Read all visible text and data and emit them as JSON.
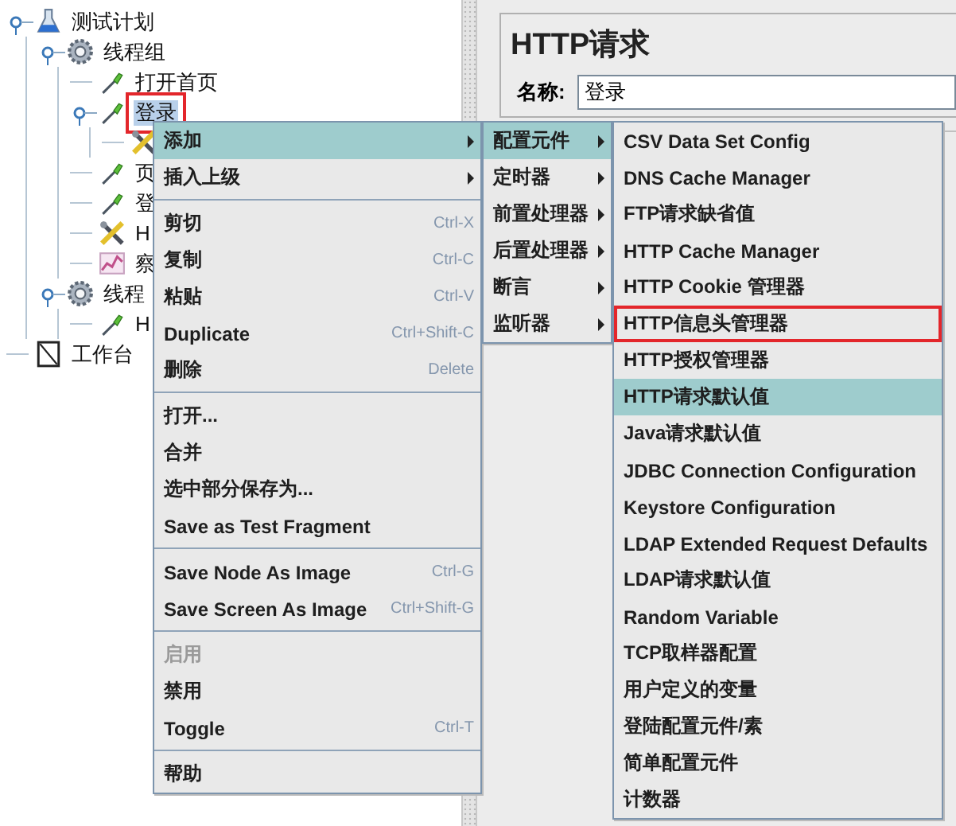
{
  "tree": {
    "nodes": [
      {
        "label": "测试计划",
        "kind": "plan",
        "selected": false,
        "marked": false,
        "expanded": true,
        "children": [
          {
            "label": "线程组",
            "kind": "thread",
            "selected": false,
            "marked": false,
            "expanded": true,
            "children": [
              {
                "label": "打开首页",
                "kind": "sampler",
                "selected": false,
                "marked": false
              },
              {
                "label": "登录",
                "kind": "sampler",
                "selected": true,
                "marked": true,
                "expanded": true,
                "children": [
                  {
                    "kind": "config"
                  }
                ]
              },
              {
                "label": "页",
                "kind": "sampler",
                "selected": false,
                "marked": false
              },
              {
                "label": "登",
                "kind": "sampler",
                "selected": false,
                "marked": false
              },
              {
                "label": "H",
                "kind": "config",
                "selected": false,
                "marked": false
              },
              {
                "label": "察",
                "kind": "listener",
                "selected": false,
                "marked": false
              }
            ]
          },
          {
            "label": "线程",
            "kind": "thread",
            "selected": false,
            "marked": false,
            "expanded": true,
            "children": [
              {
                "label": "H",
                "kind": "sampler",
                "selected": false,
                "marked": false
              }
            ]
          }
        ]
      },
      {
        "label": "工作台",
        "kind": "workbench",
        "selected": false,
        "marked": false
      }
    ]
  },
  "detail": {
    "title": "HTTP请求",
    "name_label": "名称:",
    "name_value": "登录"
  },
  "context_menu": {
    "items": [
      {
        "kind": "item",
        "label": "添加",
        "submenu": true,
        "selected": true,
        "disabled": false
      },
      {
        "kind": "item",
        "label": "插入上级",
        "submenu": true,
        "selected": false,
        "disabled": false
      },
      {
        "kind": "separator"
      },
      {
        "kind": "item",
        "label": "剪切",
        "shortcut": "Ctrl-X",
        "submenu": false,
        "selected": false,
        "disabled": false
      },
      {
        "kind": "item",
        "label": "复制",
        "shortcut": "Ctrl-C",
        "submenu": false,
        "selected": false,
        "disabled": false
      },
      {
        "kind": "item",
        "label": "粘贴",
        "shortcut": "Ctrl-V",
        "submenu": false,
        "selected": false,
        "disabled": false
      },
      {
        "kind": "item",
        "label": "Duplicate",
        "shortcut": "Ctrl+Shift-C",
        "submenu": false,
        "selected": false,
        "disabled": false
      },
      {
        "kind": "item",
        "label": "删除",
        "shortcut": "Delete",
        "submenu": false,
        "selected": false,
        "disabled": false
      },
      {
        "kind": "separator"
      },
      {
        "kind": "item",
        "label": "打开...",
        "submenu": false,
        "selected": false,
        "disabled": false
      },
      {
        "kind": "item",
        "label": "合并",
        "submenu": false,
        "selected": false,
        "disabled": false
      },
      {
        "kind": "item",
        "label": "选中部分保存为...",
        "submenu": false,
        "selected": false,
        "disabled": false
      },
      {
        "kind": "item",
        "label": "Save as Test Fragment",
        "submenu": false,
        "selected": false,
        "disabled": false
      },
      {
        "kind": "separator"
      },
      {
        "kind": "item",
        "label": "Save Node As Image",
        "shortcut": "Ctrl-G",
        "submenu": false,
        "selected": false,
        "disabled": false
      },
      {
        "kind": "item",
        "label": "Save Screen As Image",
        "shortcut": "Ctrl+Shift-G",
        "submenu": false,
        "selected": false,
        "disabled": false
      },
      {
        "kind": "separator"
      },
      {
        "kind": "item",
        "label": "启用",
        "submenu": false,
        "selected": false,
        "disabled": true
      },
      {
        "kind": "item",
        "label": "禁用",
        "submenu": false,
        "selected": false,
        "disabled": false
      },
      {
        "kind": "item",
        "label": "Toggle",
        "shortcut": "Ctrl-T",
        "submenu": false,
        "selected": false,
        "disabled": false
      },
      {
        "kind": "separator"
      },
      {
        "kind": "item",
        "label": "帮助",
        "submenu": false,
        "selected": false,
        "disabled": false
      }
    ]
  },
  "add_submenu": {
    "items": [
      {
        "kind": "item",
        "label": "配置元件",
        "submenu": true,
        "selected": true
      },
      {
        "kind": "item",
        "label": "定时器",
        "submenu": true,
        "selected": false
      },
      {
        "kind": "item",
        "label": "前置处理器",
        "submenu": true,
        "selected": false
      },
      {
        "kind": "item",
        "label": "后置处理器",
        "submenu": true,
        "selected": false
      },
      {
        "kind": "item",
        "label": "断言",
        "submenu": true,
        "selected": false
      },
      {
        "kind": "item",
        "label": "监听器",
        "submenu": true,
        "selected": false
      }
    ]
  },
  "config_submenu": {
    "items": [
      {
        "kind": "item",
        "label": "CSV Data Set Config",
        "selected": false,
        "marked": false
      },
      {
        "kind": "item",
        "label": "DNS Cache Manager",
        "selected": false,
        "marked": false
      },
      {
        "kind": "item",
        "label": "FTP请求缺省值",
        "selected": false,
        "marked": false
      },
      {
        "kind": "item",
        "label": "HTTP Cache Manager",
        "selected": false,
        "marked": false
      },
      {
        "kind": "item",
        "label": "HTTP Cookie 管理器",
        "selected": false,
        "marked": false
      },
      {
        "kind": "item",
        "label": "HTTP信息头管理器",
        "selected": false,
        "marked": true
      },
      {
        "kind": "item",
        "label": "HTTP授权管理器",
        "selected": false,
        "marked": false
      },
      {
        "kind": "item",
        "label": "HTTP请求默认值",
        "selected": true,
        "marked": false
      },
      {
        "kind": "item",
        "label": "Java请求默认值",
        "selected": false,
        "marked": false
      },
      {
        "kind": "item",
        "label": "JDBC Connection Configuration",
        "selected": false,
        "marked": false
      },
      {
        "kind": "item",
        "label": "Keystore Configuration",
        "selected": false,
        "marked": false
      },
      {
        "kind": "item",
        "label": "LDAP Extended Request Defaults",
        "selected": false,
        "marked": false
      },
      {
        "kind": "item",
        "label": "LDAP请求默认值",
        "selected": false,
        "marked": false
      },
      {
        "kind": "item",
        "label": "Random Variable",
        "selected": false,
        "marked": false
      },
      {
        "kind": "item",
        "label": "TCP取样器配置",
        "selected": false,
        "marked": false
      },
      {
        "kind": "item",
        "label": "用户定义的变量",
        "selected": false,
        "marked": false
      },
      {
        "kind": "item",
        "label": "登陆配置元件/素",
        "selected": false,
        "marked": false
      },
      {
        "kind": "item",
        "label": "简单配置元件",
        "selected": false,
        "marked": false
      },
      {
        "kind": "item",
        "label": "计数器",
        "selected": false,
        "marked": false
      }
    ]
  }
}
